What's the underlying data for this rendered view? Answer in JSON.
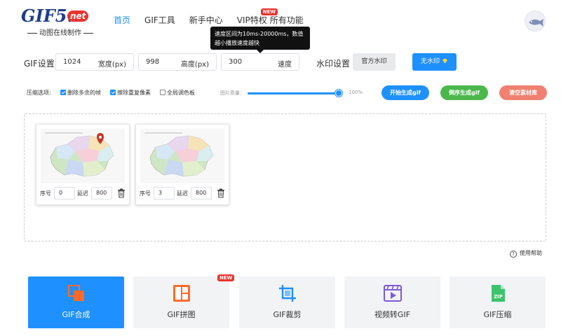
{
  "logo": {
    "main": "GIF5.",
    "net": "net",
    "subtitle": "动图在线制作"
  },
  "nav": [
    {
      "label": "首页",
      "active": true
    },
    {
      "label": "GIF工具",
      "active": false
    },
    {
      "label": "新手中心",
      "active": false
    },
    {
      "label": "VIP特权",
      "active": false,
      "badge": "NEW"
    },
    {
      "label": "所有功能",
      "active": false
    }
  ],
  "tooltip": {
    "text": "速度区间为10ms-20000ms，数值越小播放速度越快"
  },
  "settings": {
    "label": "GIF设置：",
    "width": {
      "value": "1024",
      "unit": "宽度(px)"
    },
    "height": {
      "value": "998",
      "unit": "高度(px)"
    },
    "speed": {
      "value": "300",
      "unit": "速度"
    },
    "watermark_label": "水印设置",
    "official_watermark": "官方水印",
    "no_watermark": "无水印"
  },
  "compress": {
    "label": "压缩选项:",
    "options": [
      {
        "label": "删除多余的帧",
        "checked": true
      },
      {
        "label": "擦除重复像素",
        "checked": true
      },
      {
        "label": "全局调色板",
        "checked": false
      }
    ],
    "quality_label": "图片质量：",
    "quality_value": "100%",
    "quality_fraction": 1.0
  },
  "actions": {
    "generate": "开始生成gif",
    "reverse": "倒序生成gif",
    "clear": "清空素材库"
  },
  "frames": [
    {
      "index_label": "序号",
      "index": "0",
      "delay_label": "延迟",
      "delay": "800"
    },
    {
      "index_label": "序号",
      "index": "3",
      "delay_label": "延迟",
      "delay": "800"
    }
  ],
  "help": "使用帮助",
  "tools": [
    {
      "label": "GIF合成",
      "icon": "merge-icon",
      "active": true
    },
    {
      "label": "GIF拼图",
      "icon": "collage-icon",
      "badge": "NEW"
    },
    {
      "label": "GIF裁剪",
      "icon": "crop-icon"
    },
    {
      "label": "视频转GIF",
      "icon": "video-icon"
    },
    {
      "label": "GIF压缩",
      "icon": "zip-icon"
    }
  ],
  "colors": {
    "accent": "#1e90ff",
    "green": "#4cb84c",
    "salmon": "#f08070",
    "orange": "#ff6a2b",
    "purple": "#7a5bd9",
    "zip_green": "#3cc46b"
  }
}
